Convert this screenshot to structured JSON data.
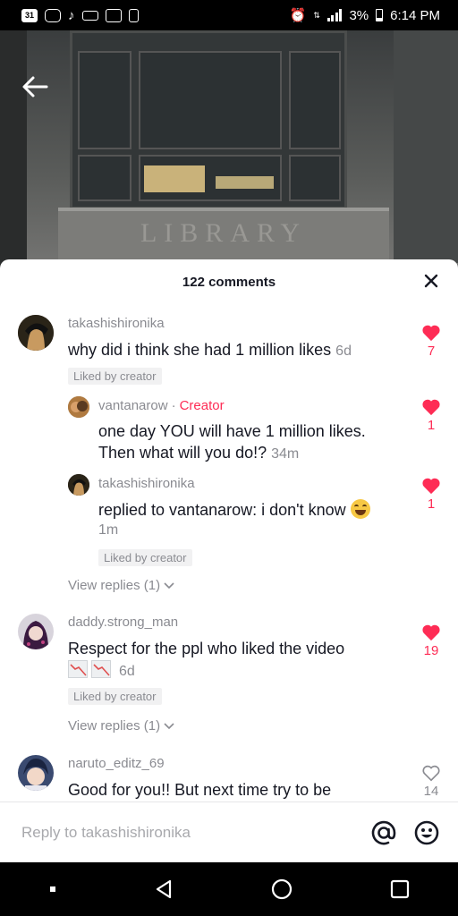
{
  "status_bar": {
    "calendar_day": "31",
    "battery": "3%",
    "time": "6:14 PM",
    "left_icons": [
      "calendar-icon",
      "instagram-icon",
      "tiktok-icon",
      "voicemail-icon",
      "image-icon",
      "battery-saver-icon"
    ],
    "right_icons": [
      "alarm-icon",
      "4g-lte-icon",
      "signal-icon",
      "battery-icon"
    ]
  },
  "video": {
    "sign_text": "LIBRARY"
  },
  "sheet": {
    "comment_count": "122 comments",
    "comments": [
      {
        "username": "takashishironika",
        "text": "why did i think she had 1 million likes",
        "time": "6d",
        "badge": "Liked by creator",
        "likes": "7",
        "liked": true
      },
      {
        "username": "vantanarow",
        "role": "Creator",
        "text_line1": "one day YOU will have 1 million likes.",
        "text_line2": "Then what will you do!?",
        "time": "34m",
        "likes": "1",
        "liked": true
      },
      {
        "username": "takashishironika",
        "text": "replied to vantanarow: i don't know",
        "time": "1m",
        "badge": "Liked by creator",
        "likes": "1",
        "liked": true
      },
      {
        "username": "daddy.strong_man",
        "text": "Respect for the ppl who liked the video",
        "time": "6d",
        "badge": "Liked by creator",
        "likes": "19",
        "liked": true
      },
      {
        "username": "naruto_editz_69",
        "text": "Good for you!! But next time try to be",
        "likes": "14",
        "liked": false
      }
    ],
    "view_replies": "View replies (1)"
  },
  "reply_bar": {
    "placeholder": "Reply to takashishironika"
  },
  "colors": {
    "accent": "#fe2c55",
    "muted": "#8a8b91",
    "text": "#161823"
  }
}
